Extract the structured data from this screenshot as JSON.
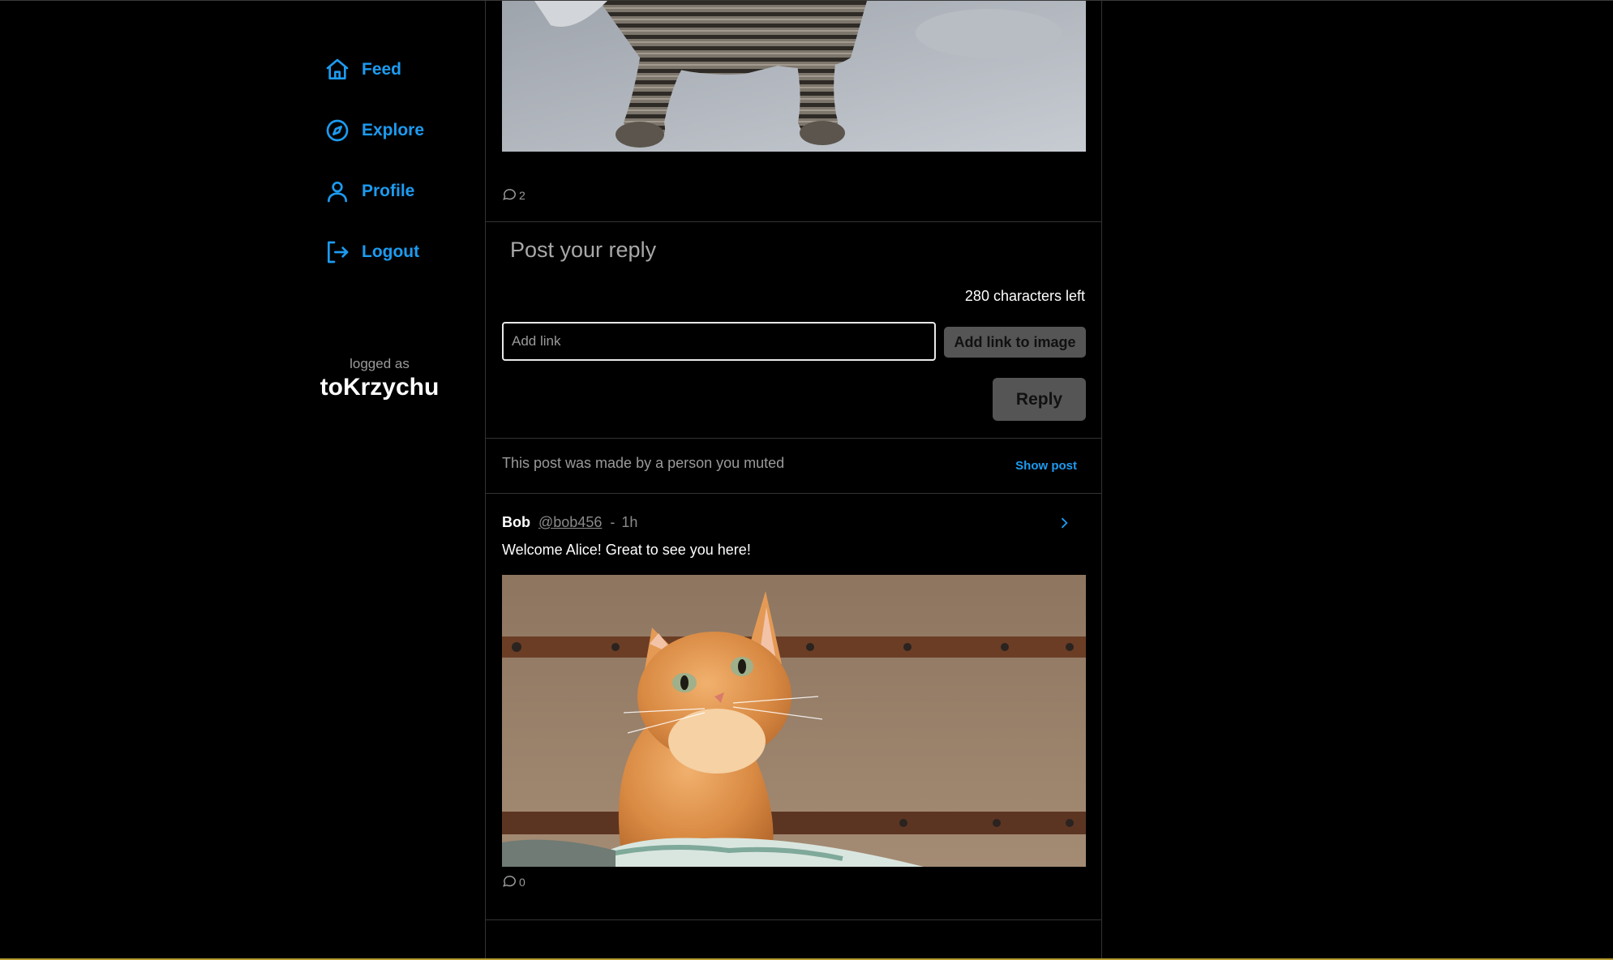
{
  "nav": {
    "items": [
      {
        "label": "Feed",
        "icon": "home-icon"
      },
      {
        "label": "Explore",
        "icon": "compass-icon"
      },
      {
        "label": "Profile",
        "icon": "user-icon"
      },
      {
        "label": "Logout",
        "icon": "logout-icon"
      }
    ]
  },
  "session": {
    "caption": "logged as",
    "username": "toKrzychu"
  },
  "top_post": {
    "comment_count": "2"
  },
  "reply_form": {
    "placeholder": "Post your reply",
    "chars_left": "280 characters left",
    "link_placeholder": "Add link",
    "add_link_label": "Add link to image",
    "reply_label": "Reply"
  },
  "muted_post": {
    "text": "This post was made by a person you muted",
    "show_label": "Show post"
  },
  "post": {
    "author": "Bob",
    "handle": "@bob456",
    "separator": "-",
    "time": "1h",
    "text": "Welcome Alice! Great to see you here!",
    "comment_count": "0"
  },
  "colors": {
    "accent": "#1d9bf0",
    "background": "#000000",
    "muted_text": "#9a9a9a",
    "button_bg": "#555555"
  }
}
